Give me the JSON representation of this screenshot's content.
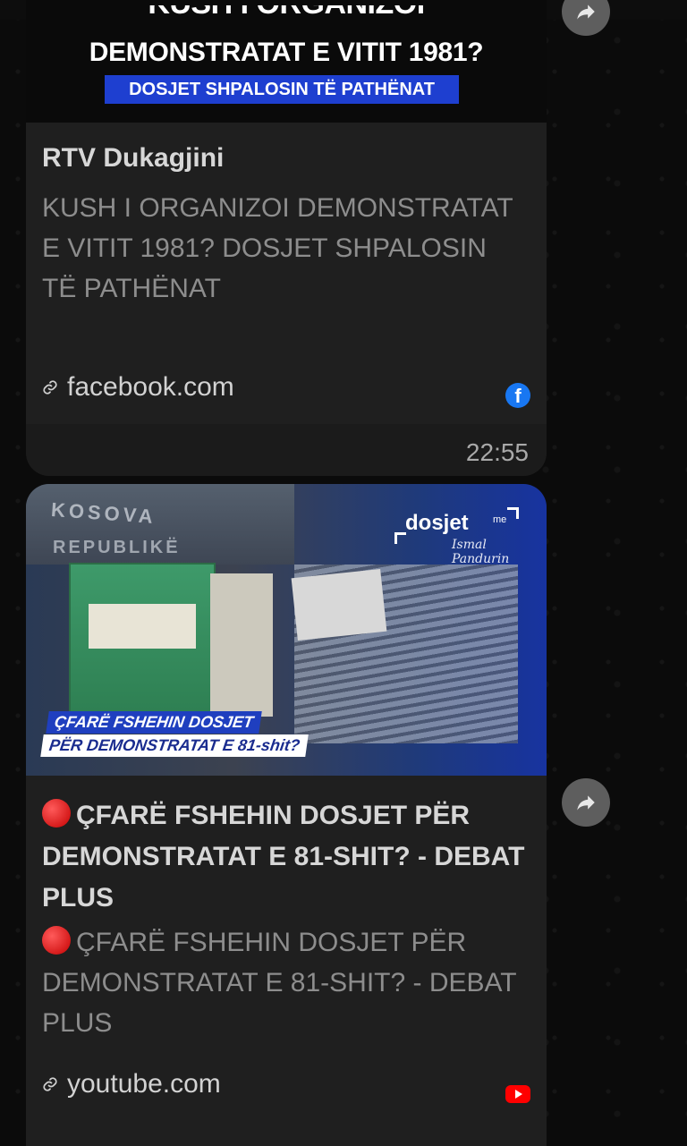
{
  "messages": [
    {
      "banner": {
        "line1": "KUSH I ORGANIZOI",
        "line2": "DEMONSTRATAT E VITIT 1981?",
        "tag": "DOSJET SHPALOSIN TË PATHËNAT"
      },
      "sender": "RTV Dukagjini",
      "description": "KUSH I ORGANIZOI DEMONSTRATAT E VITIT 1981? DOSJET SHPALOSIN TË PATHËNAT",
      "link_domain": "facebook.com",
      "source_icon": "facebook-icon",
      "time": "22:55"
    },
    {
      "thumbnail": {
        "flag_text_1": "KOSOVA",
        "flag_text_2": "REPUBLIKË",
        "logo": "dosjet",
        "logo_me": "me",
        "logo_signature": "Ismal Pandurin",
        "caption_1": "ÇFARË FSHEHIN DOSJET",
        "caption_2": "PËR DEMONSTRATAT E 81-shit?"
      },
      "title": "ÇFARË FSHEHIN DOSJET PËR DEMONSTRATAT E 81-SHIT? - DEBAT PLUS",
      "description": "ÇFARË FSHEHIN DOSJET PËR DEMONSTRATAT E 81-SHIT? - DEBAT PLUS",
      "link_domain": "youtube.com",
      "source_icon": "youtube-icon"
    }
  ],
  "colors": {
    "background": "#0b0b0b",
    "bubble": "#1f1f1f",
    "banner_tag": "#1e3fd0",
    "facebook": "#1877f2",
    "youtube": "#ff0000",
    "forward_button": "#5e5e5e"
  }
}
